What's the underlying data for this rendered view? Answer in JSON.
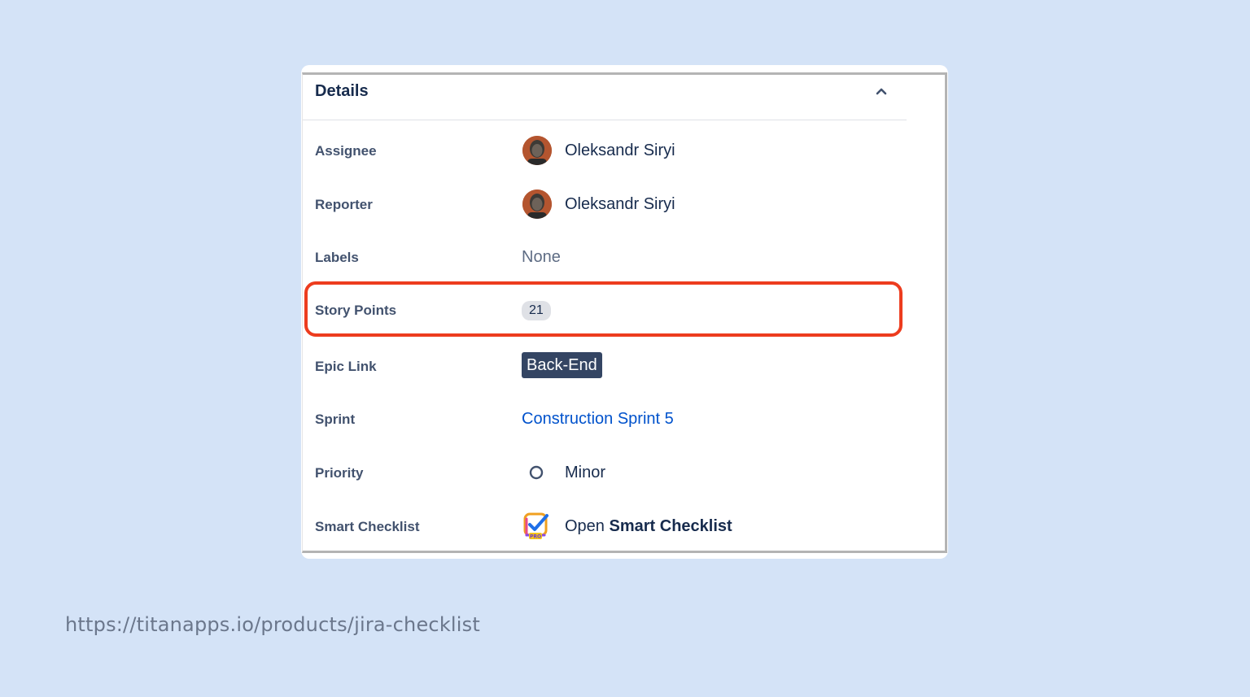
{
  "details": {
    "title": "Details",
    "collapse_icon": "chevron-up-icon",
    "fields": {
      "assignee": {
        "label": "Assignee",
        "value": "Oleksandr Siryi",
        "icon": "avatar"
      },
      "reporter": {
        "label": "Reporter",
        "value": "Oleksandr Siryi",
        "icon": "avatar"
      },
      "labels": {
        "label": "Labels",
        "value": "None"
      },
      "story_points": {
        "label": "Story Points",
        "value": "21"
      },
      "epic_link": {
        "label": "Epic Link",
        "value": "Back-End"
      },
      "sprint": {
        "label": "Sprint",
        "value": "Construction Sprint 5"
      },
      "priority": {
        "label": "Priority",
        "value": "Minor",
        "icon": "priority-minor-icon"
      },
      "smart_checklist": {
        "label": "Smart Checklist",
        "prefix": "Open",
        "value": "Smart Checklist",
        "icon": "smart-checklist-icon"
      }
    }
  },
  "highlight_color": "#ed3c1e",
  "link_color": "#0052cc",
  "footer_url": "https://titanapps.io/products/jira-checklist"
}
